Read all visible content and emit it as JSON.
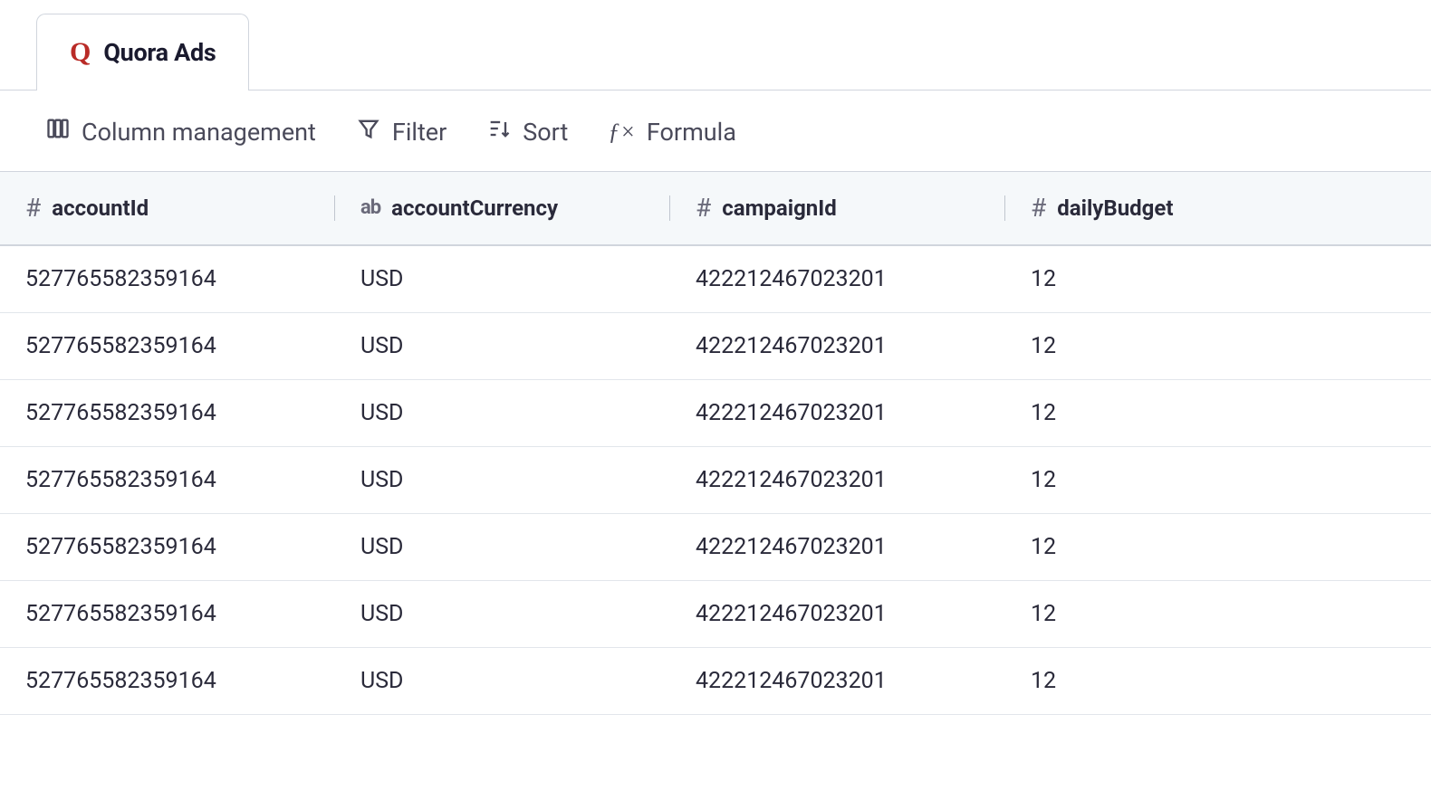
{
  "tab": {
    "icon_letter": "Q",
    "label": "Quora Ads"
  },
  "toolbar": {
    "column_management": "Column management",
    "filter": "Filter",
    "sort": "Sort",
    "formula": "Formula"
  },
  "columns": [
    {
      "type": "number",
      "label": "accountId"
    },
    {
      "type": "text",
      "label": "accountCurrency"
    },
    {
      "type": "number",
      "label": "campaignId"
    },
    {
      "type": "number",
      "label": "dailyBudget"
    }
  ],
  "rows": [
    {
      "accountId": "527765582359164",
      "accountCurrency": "USD",
      "campaignId": "422212467023201",
      "dailyBudget": "12"
    },
    {
      "accountId": "527765582359164",
      "accountCurrency": "USD",
      "campaignId": "422212467023201",
      "dailyBudget": "12"
    },
    {
      "accountId": "527765582359164",
      "accountCurrency": "USD",
      "campaignId": "422212467023201",
      "dailyBudget": "12"
    },
    {
      "accountId": "527765582359164",
      "accountCurrency": "USD",
      "campaignId": "422212467023201",
      "dailyBudget": "12"
    },
    {
      "accountId": "527765582359164",
      "accountCurrency": "USD",
      "campaignId": "422212467023201",
      "dailyBudget": "12"
    },
    {
      "accountId": "527765582359164",
      "accountCurrency": "USD",
      "campaignId": "422212467023201",
      "dailyBudget": "12"
    },
    {
      "accountId": "527765582359164",
      "accountCurrency": "USD",
      "campaignId": "422212467023201",
      "dailyBudget": "12"
    }
  ]
}
